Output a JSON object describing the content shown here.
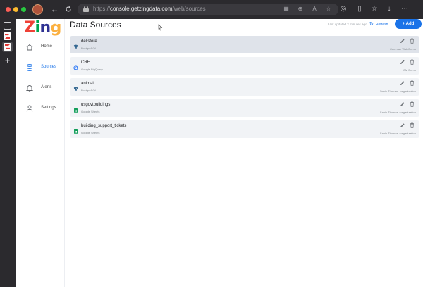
{
  "browser": {
    "url_scheme": "https://",
    "url_host": "console.getzingdata.com",
    "url_path": "/web/sources",
    "icons": {
      "back": "arrow-left-icon",
      "forward": "arrow-right-icon",
      "reload": "reload-icon",
      "url_bar": [
        "reader-icon",
        "zoom-icon",
        "read-aloud-icon",
        "favorite-star-icon"
      ],
      "toolbar": [
        "extensions-icon",
        "split-screen-icon",
        "favorites-icon",
        "downloads-icon",
        "more-icon"
      ]
    }
  },
  "app": {
    "logo_text": "Zing",
    "logo_colors": [
      "#ef4136",
      "#00a651",
      "#2e3192",
      "#fbb040"
    ],
    "nav": [
      {
        "label": "Home",
        "icon": "home-icon",
        "active": false
      },
      {
        "label": "Sources",
        "icon": "database-icon",
        "active": true
      },
      {
        "label": "Alerts",
        "icon": "bell-icon",
        "active": false
      },
      {
        "label": "Settings",
        "icon": "person-icon",
        "active": false
      }
    ]
  },
  "header": {
    "title": "Data Sources",
    "last_updated": "Last updated 2 minutes ago",
    "refresh_label": "Refresh",
    "add_label": "+ Add"
  },
  "sources": [
    {
      "name": "dellstore",
      "type": "PostgreSQL",
      "owner": "Cumman WaleDemo",
      "icon": "postgresql-icon",
      "hovered": true
    },
    {
      "name": "CRE",
      "type": "Google BigQuery",
      "owner": "CM Demo",
      "icon": "bigquery-icon",
      "hovered": false
    },
    {
      "name": "animal",
      "type": "PostgreSQL",
      "owner": "Sabin Thomas · organization",
      "icon": "postgresql-icon",
      "hovered": false
    },
    {
      "name": "usgovtbuildings",
      "type": "Google Sheets",
      "owner": "Sabin Thomas · organization",
      "icon": "google-sheets-icon",
      "hovered": false
    },
    {
      "name": "building_support_tickets",
      "type": "Google Sheets",
      "owner": "Sabin Thomas · organization",
      "icon": "google-sheets-icon",
      "hovered": false
    }
  ],
  "colors": {
    "accent": "#1a73e8",
    "row_bg": "#f1f3f6",
    "row_hover_bg": "#dfe3ea",
    "chrome_bg": "#2b2a2e"
  }
}
